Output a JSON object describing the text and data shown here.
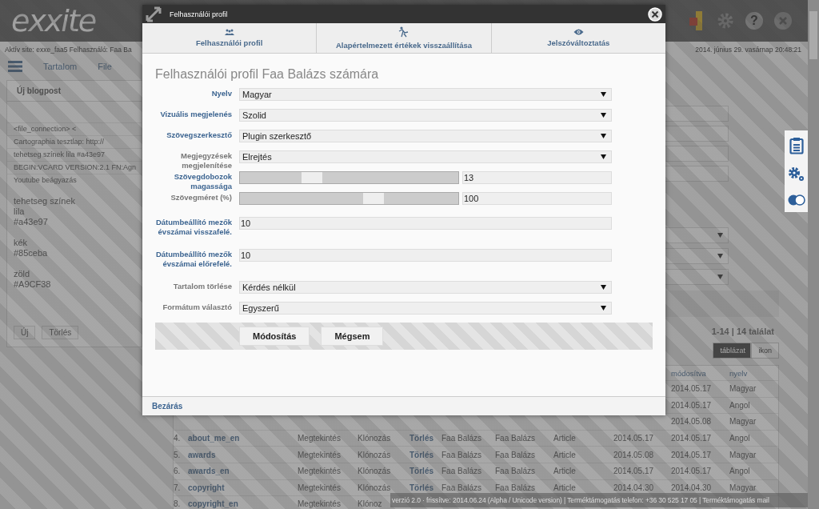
{
  "header": {
    "logo": "exxite",
    "help_symbol": "?"
  },
  "info_bar": {
    "site_text": "Aktív site: exxe_faa5 Felhasználó: Faa Ba",
    "datetime": "2014. június 29. vasárnap 20:48:21"
  },
  "menu": [
    "Tartalom",
    "File"
  ],
  "left_panel": {
    "new_button": "Új blogpost",
    "items": [
      "<file_connection> <",
      "Cartographia tesztlap: http://",
      "tehetseg színek lila #a43e97",
      "BEGIN:VCARD VERSION:2.1 FN:Agn",
      "Youtube beágyazás"
    ],
    "note_groups": [
      [
        "tehetseg színek",
        "lila",
        "#a43e97"
      ],
      [
        "kék",
        "#85ceba"
      ],
      [
        "zöld",
        "#A9CF38"
      ]
    ],
    "buttons": [
      "Új",
      "Törlés"
    ]
  },
  "results": {
    "count": "1-14 | 14 találat",
    "views": [
      {
        "label": "táblázat",
        "selected": true
      },
      {
        "label": "ikon",
        "selected": false
      }
    ]
  },
  "table": {
    "columns": [
      null,
      null,
      null,
      null,
      null,
      null,
      null,
      null,
      null,
      "módosítva",
      "nyelv"
    ],
    "rows": [
      {
        "cells": [
          null,
          null,
          null,
          null,
          null,
          null,
          null,
          null,
          null,
          "2014.05.17",
          "Magyar"
        ]
      },
      {
        "cells": [
          null,
          null,
          null,
          null,
          null,
          null,
          null,
          null,
          null,
          "2014.05.17",
          "Angol"
        ]
      },
      {
        "cells": [
          null,
          null,
          null,
          null,
          null,
          null,
          null,
          null,
          null,
          "2014.05.08",
          "Magyar"
        ]
      },
      {
        "cells": [
          "4.",
          "about_me_en",
          "Megtekintés",
          "Klónozás",
          "Törlés",
          "Faa Balázs",
          "Faa Balázs",
          "Article",
          "2014.05.17",
          "2014.05.17",
          "Angol"
        ]
      },
      {
        "cells": [
          "5.",
          "awards",
          "Megtekintés",
          "Klónozás",
          "Törlés",
          "Faa Balázs",
          "Faa Balázs",
          "Article",
          "2014.05.08",
          "2014.05.17",
          "Magyar"
        ]
      },
      {
        "cells": [
          "6.",
          "awards_en",
          "Megtekintés",
          "Klónozás",
          "Törlés",
          "Faa Balázs",
          "Faa Balázs",
          "Article",
          "2014.05.17",
          "2014.05.17",
          "Angol"
        ]
      },
      {
        "cells": [
          "7.",
          "copyright",
          "Megtekintés",
          "Klónozás",
          "Törlés",
          "Faa Balázs",
          "Faa Balázs",
          "Article",
          "2014.04.30",
          "2014.04.30",
          "Magyar"
        ]
      },
      {
        "cells": [
          "8.",
          "copyright_en",
          "Megtekintés",
          "Klónoz",
          null,
          null,
          null,
          null,
          null,
          null,
          null
        ]
      }
    ]
  },
  "footer": "verzió 2.0  ·  frissítve: 2014.06.24 (Alpha / Unicode version) | Terméktámogatás telefon: +36 30 525 17 05 | Terméktámogatás mail",
  "modal": {
    "title": "Felhasználói profil",
    "tabs": [
      "Felhasználói profil",
      "Alapértelmezett értékek visszaállítása",
      "Jelszóváltoztatás"
    ],
    "heading": "Felhasználói profil Faa Balázs számára",
    "fields": [
      {
        "kind": "select",
        "label": "Nyelv",
        "highlighted": true,
        "value": "Magyar"
      },
      {
        "kind": "select",
        "label": "Vizuális megjelenés",
        "highlighted": true,
        "value": "Szolid"
      },
      {
        "kind": "select",
        "label": "Szövegszerkesztő",
        "highlighted": true,
        "value": "Plugin szerkesztő"
      },
      {
        "kind": "select",
        "label": "Megjegyzések megjelenítése",
        "highlighted": false,
        "value": "Elrejtés"
      },
      {
        "kind": "slider",
        "label": "Szövegdobozok magassága",
        "highlighted": true,
        "level": 0.33,
        "value": "13"
      },
      {
        "kind": "slider",
        "label": "Szövegméret (%)",
        "highlighted": false,
        "level": 0.61,
        "value": "100"
      },
      {
        "kind": "text",
        "label": "Dátumbeállító mezők évszámai visszafelé.",
        "highlighted": true,
        "value": "10"
      },
      {
        "kind": "text",
        "label": "Dátumbeállító mezők évszámai előrefelé.",
        "highlighted": true,
        "value": "10"
      },
      {
        "kind": "select",
        "label": "Tartalom törlése",
        "highlighted": false,
        "value": "Kérdés nélkül"
      },
      {
        "kind": "select",
        "label": "Formátum választó",
        "highlighted": false,
        "value": "Egyszerű"
      }
    ],
    "buttons": [
      "Módosítás",
      "Mégsem"
    ],
    "close_link": "Bezárás"
  }
}
